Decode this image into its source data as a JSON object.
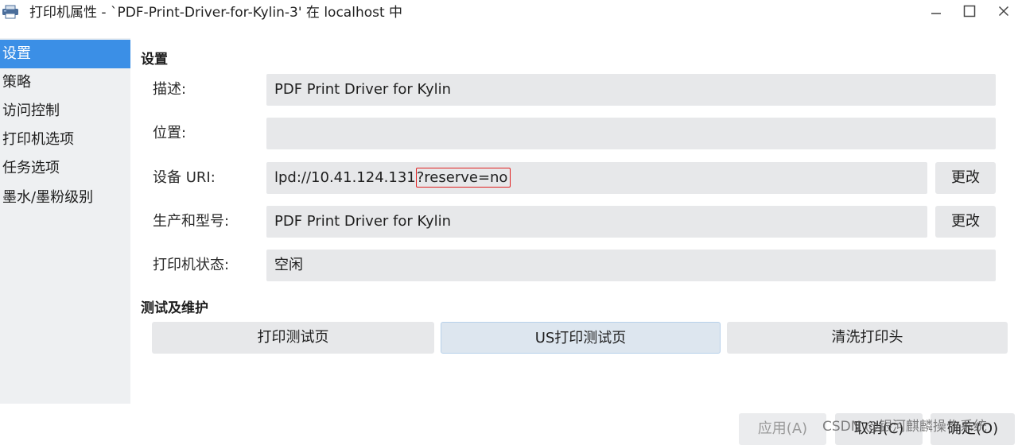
{
  "window": {
    "title": "打印机属性 - `PDF-Print-Driver-for-Kylin-3' 在 localhost 中",
    "icon": "printer-icon",
    "controls": [
      "minimize-icon",
      "maximize-icon",
      "close-icon"
    ]
  },
  "sidebar": {
    "items": [
      {
        "label": "设置",
        "selected": true
      },
      {
        "label": "策略",
        "selected": false
      },
      {
        "label": "访问控制",
        "selected": false
      },
      {
        "label": "打印机选项",
        "selected": false
      },
      {
        "label": "任务选项",
        "selected": false
      },
      {
        "label": "墨水/墨粉级别",
        "selected": false
      }
    ],
    "selected_color": "#3b8fe6"
  },
  "settings": {
    "heading": "设置",
    "description": {
      "label": "描述:",
      "value": "PDF Print Driver for Kylin"
    },
    "location": {
      "label": "位置:",
      "value": ""
    },
    "device_uri": {
      "label": "设备 URI:",
      "value_prefix": "lpd://10.41.124.131",
      "value_highlighted": "?reserve=no",
      "highlight_color": "#e02020",
      "change_label": "更改"
    },
    "make_model": {
      "label": "生产和型号:",
      "value": "PDF Print Driver for Kylin",
      "change_label": "更改"
    },
    "printer_state": {
      "label": "打印机状态:",
      "value": "空闲"
    }
  },
  "maintenance": {
    "heading": "测试及维护",
    "buttons": [
      "打印测试页",
      "US打印测试页",
      "清洗打印头"
    ]
  },
  "footer": {
    "apply_label": "应用(A)",
    "cancel_label": "取消(C)",
    "ok_label": "确定(O)"
  },
  "watermark": "CSDN @银河麒麟操作系统"
}
